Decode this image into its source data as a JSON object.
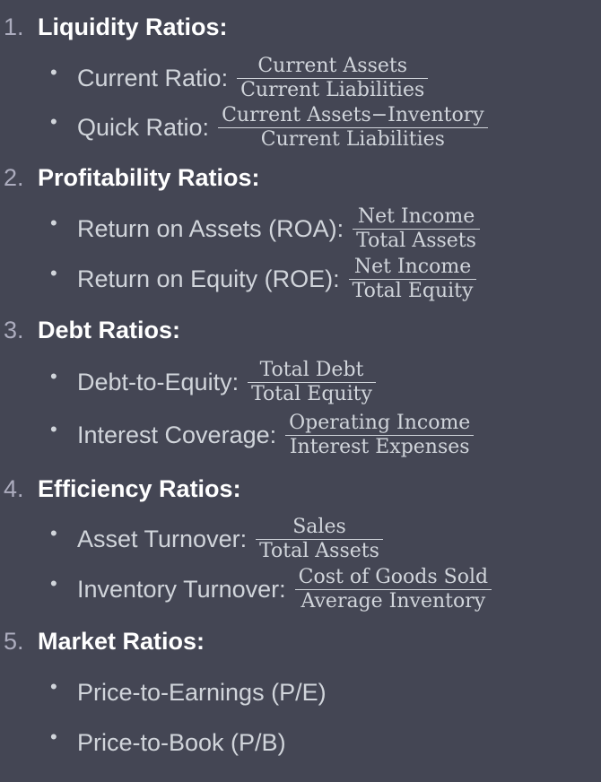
{
  "sections": [
    {
      "number": "1.",
      "title": "Liquidity Ratios:",
      "items": [
        {
          "label": "Current Ratio:",
          "numerator": "Current Assets",
          "denominator": "Current Liabilities"
        },
        {
          "label": "Quick Ratio:",
          "numerator": "Current Assets−Inventory",
          "denominator": "Current Liabilities"
        }
      ]
    },
    {
      "number": "2.",
      "title": "Profitability Ratios:",
      "items": [
        {
          "label": "Return on Assets (ROA):",
          "numerator": "Net Income",
          "denominator": "Total Assets"
        },
        {
          "label": "Return on Equity (ROE):",
          "numerator": "Net Income",
          "denominator": "Total Equity"
        }
      ]
    },
    {
      "number": "3.",
      "title": "Debt Ratios:",
      "items": [
        {
          "label": "Debt-to-Equity:",
          "numerator": "Total Debt",
          "denominator": "Total Equity"
        },
        {
          "label": "Interest Coverage:",
          "numerator": "Operating Income",
          "denominator": "Interest Expenses"
        }
      ]
    },
    {
      "number": "4.",
      "title": "Efficiency Ratios:",
      "items": [
        {
          "label": "Asset Turnover:",
          "numerator": "Sales",
          "denominator": "Total Assets"
        },
        {
          "label": "Inventory Turnover:",
          "numerator": "Cost of Goods Sold",
          "denominator": "Average Inventory"
        }
      ]
    },
    {
      "number": "5.",
      "title": "Market Ratios:",
      "items": [
        {
          "label": "Price-to-Earnings (P/E)"
        },
        {
          "label": "Price-to-Book (P/B)"
        }
      ]
    }
  ],
  "bullet_glyph": "•"
}
